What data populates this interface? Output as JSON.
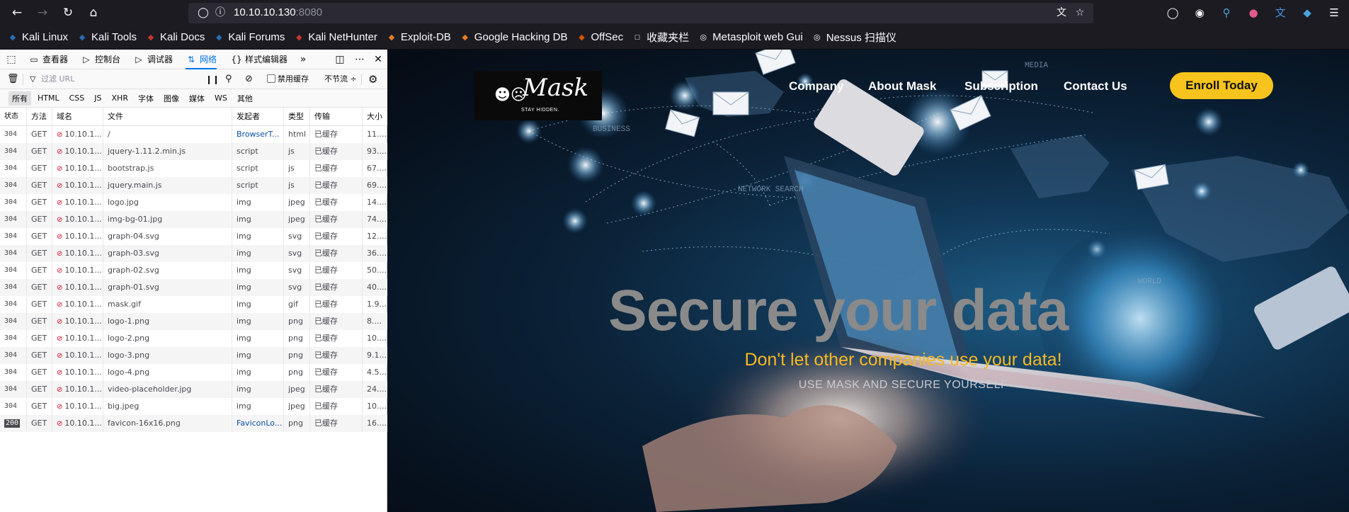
{
  "browser": {
    "url_host": "10.10.10.130",
    "url_port": ":8080",
    "bookmarks": [
      {
        "label": "Kali Linux",
        "icon": "kali-icon",
        "color": "#2b6cb0"
      },
      {
        "label": "Kali Tools",
        "icon": "kali-tools-icon",
        "color": "#2b6cb0"
      },
      {
        "label": "Kali Docs",
        "icon": "kali-docs-icon",
        "color": "#c0392b"
      },
      {
        "label": "Kali Forums",
        "icon": "kali-forums-icon",
        "color": "#2b6cb0"
      },
      {
        "label": "Kali NetHunter",
        "icon": "nethunter-icon",
        "color": "#c0392b"
      },
      {
        "label": "Exploit-DB",
        "icon": "exploit-db-icon",
        "color": "#e67e22"
      },
      {
        "label": "Google Hacking DB",
        "icon": "ghdb-icon",
        "color": "#e67e22"
      },
      {
        "label": "OffSec",
        "icon": "offsec-icon",
        "color": "#d35400"
      },
      {
        "label": "收藏夹栏",
        "icon": "folder-icon",
        "color": "#fbfbfe"
      },
      {
        "label": "Metasploit web Gui",
        "icon": "globe-icon",
        "color": "#fbfbfe"
      },
      {
        "label": "Nessus 扫描仪",
        "icon": "globe-icon",
        "color": "#fbfbfe"
      }
    ]
  },
  "devtools": {
    "tabs": [
      {
        "label": "查看器",
        "icon": "inspector-icon"
      },
      {
        "label": "控制台",
        "icon": "console-icon"
      },
      {
        "label": "调试器",
        "icon": "debugger-icon"
      },
      {
        "label": "网络",
        "icon": "network-icon",
        "active": true
      },
      {
        "label": "样式编辑器",
        "icon": "style-editor-icon"
      }
    ],
    "filter_placeholder": "过滤 URL",
    "disable_cache_label": "禁用缓存",
    "throttle_label": "不节流 ÷",
    "type_filters": [
      "所有",
      "HTML",
      "CSS",
      "JS",
      "XHR",
      "字体",
      "图像",
      "媒体",
      "WS",
      "其他"
    ],
    "columns": [
      "状态",
      "方法",
      "域名",
      "文件",
      "发起者",
      "类型",
      "传输",
      "大小"
    ],
    "rows": [
      {
        "status": "304",
        "method": "GET",
        "domain": "10.10.1...",
        "file": "/",
        "initiator": "BrowserT...",
        "initiator_link": true,
        "type": "html",
        "transfer": "已缓存",
        "size": "11...."
      },
      {
        "status": "304",
        "method": "GET",
        "domain": "10.10.1...",
        "file": "jquery-1.11.2.min.js",
        "initiator": "script",
        "initiator_link": false,
        "type": "js",
        "transfer": "已缓存",
        "size": "93...."
      },
      {
        "status": "304",
        "method": "GET",
        "domain": "10.10.1...",
        "file": "bootstrap.js",
        "initiator": "script",
        "initiator_link": false,
        "type": "js",
        "transfer": "已缓存",
        "size": "67...."
      },
      {
        "status": "304",
        "method": "GET",
        "domain": "10.10.1...",
        "file": "jquery.main.js",
        "initiator": "script",
        "initiator_link": false,
        "type": "js",
        "transfer": "已缓存",
        "size": "69...."
      },
      {
        "status": "304",
        "method": "GET",
        "domain": "10.10.1...",
        "file": "logo.jpg",
        "initiator": "img",
        "initiator_link": false,
        "type": "jpeg",
        "transfer": "已缓存",
        "size": "14...."
      },
      {
        "status": "304",
        "method": "GET",
        "domain": "10.10.1...",
        "file": "img-bg-01.jpg",
        "initiator": "img",
        "initiator_link": false,
        "type": "jpeg",
        "transfer": "已缓存",
        "size": "74...."
      },
      {
        "status": "304",
        "method": "GET",
        "domain": "10.10.1...",
        "file": "graph-04.svg",
        "initiator": "img",
        "initiator_link": false,
        "type": "svg",
        "transfer": "已缓存",
        "size": "12...."
      },
      {
        "status": "304",
        "method": "GET",
        "domain": "10.10.1...",
        "file": "graph-03.svg",
        "initiator": "img",
        "initiator_link": false,
        "type": "svg",
        "transfer": "已缓存",
        "size": "36...."
      },
      {
        "status": "304",
        "method": "GET",
        "domain": "10.10.1...",
        "file": "graph-02.svg",
        "initiator": "img",
        "initiator_link": false,
        "type": "svg",
        "transfer": "已缓存",
        "size": "50...."
      },
      {
        "status": "304",
        "method": "GET",
        "domain": "10.10.1...",
        "file": "graph-01.svg",
        "initiator": "img",
        "initiator_link": false,
        "type": "svg",
        "transfer": "已缓存",
        "size": "40...."
      },
      {
        "status": "304",
        "method": "GET",
        "domain": "10.10.1...",
        "file": "mask.gif",
        "initiator": "img",
        "initiator_link": false,
        "type": "gif",
        "transfer": "已缓存",
        "size": "1.9..."
      },
      {
        "status": "304",
        "method": "GET",
        "domain": "10.10.1...",
        "file": "logo-1.png",
        "initiator": "img",
        "initiator_link": false,
        "type": "png",
        "transfer": "已缓存",
        "size": "8...."
      },
      {
        "status": "304",
        "method": "GET",
        "domain": "10.10.1...",
        "file": "logo-2.png",
        "initiator": "img",
        "initiator_link": false,
        "type": "png",
        "transfer": "已缓存",
        "size": "10...."
      },
      {
        "status": "304",
        "method": "GET",
        "domain": "10.10.1...",
        "file": "logo-3.png",
        "initiator": "img",
        "initiator_link": false,
        "type": "png",
        "transfer": "已缓存",
        "size": "9.1..."
      },
      {
        "status": "304",
        "method": "GET",
        "domain": "10.10.1...",
        "file": "logo-4.png",
        "initiator": "img",
        "initiator_link": false,
        "type": "png",
        "transfer": "已缓存",
        "size": "4.5..."
      },
      {
        "status": "304",
        "method": "GET",
        "domain": "10.10.1...",
        "file": "video-placeholder.jpg",
        "initiator": "img",
        "initiator_link": false,
        "type": "jpeg",
        "transfer": "已缓存",
        "size": "24...."
      },
      {
        "status": "304",
        "method": "GET",
        "domain": "10.10.1...",
        "file": "big.jpeg",
        "initiator": "img",
        "initiator_link": false,
        "type": "jpeg",
        "transfer": "已缓存",
        "size": "10...."
      },
      {
        "status": "200",
        "method": "GET",
        "domain": "10.10.1...",
        "file": "favicon-16x16.png",
        "initiator": "FaviconLo...",
        "initiator_link": true,
        "type": "png",
        "transfer": "已缓存",
        "size": "16...."
      }
    ]
  },
  "site": {
    "logo_text": "Mask",
    "logo_tagline": "STAY HIDDEN.",
    "nav": [
      "Company",
      "About Mask",
      "Subscription",
      "Contact Us"
    ],
    "cta": "Enroll Today",
    "hero_title": "Secure your data",
    "hero_subtitle": "Don't let other companies use your data!",
    "hero_tagline": "USE MASK AND SECURE YOURSELF",
    "accent_color": "#f6c41c",
    "art_labels": [
      "MEDIA",
      "BUSINESS",
      "NETWORK SEARCH",
      "WORLD"
    ]
  }
}
